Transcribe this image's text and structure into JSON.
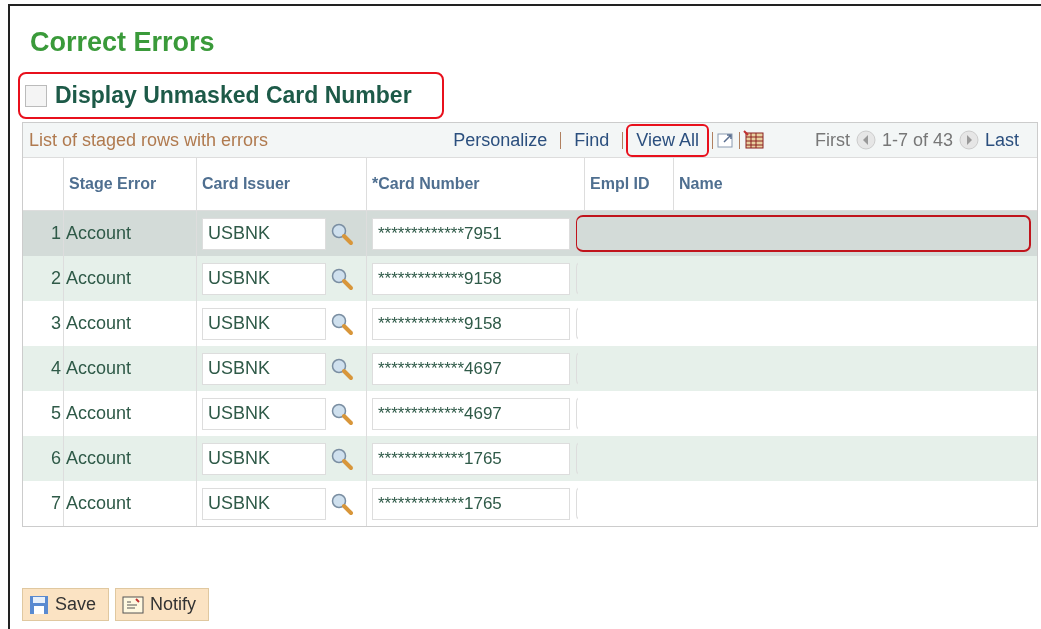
{
  "title": "Correct Errors",
  "unmask_option": {
    "label": "Display Unmasked Card Number",
    "checked": false,
    "highlighted": true
  },
  "grid": {
    "caption": "List of staged rows with errors",
    "links": [
      {
        "label": "Personalize",
        "highlighted": false
      },
      {
        "label": "Find",
        "highlighted": false
      },
      {
        "label": "View All",
        "highlighted": true
      }
    ],
    "pager": {
      "first": "First",
      "range": "1-7 of 43",
      "last": "Last"
    },
    "columns": [
      "Stage Error",
      "Card Issuer",
      "*Card Number",
      "Empl ID",
      "Name"
    ],
    "rows": [
      {
        "number": "1",
        "stage_error": "Account",
        "card_issuer": "USBNK",
        "card_number": "*************7951",
        "selected": true,
        "highlighted": true
      },
      {
        "number": "2",
        "stage_error": "Account",
        "card_issuer": "USBNK",
        "card_number": "*************9158",
        "selected": false,
        "highlighted": false
      },
      {
        "number": "3",
        "stage_error": "Account",
        "card_issuer": "USBNK",
        "card_number": "*************9158",
        "selected": false,
        "highlighted": false
      },
      {
        "number": "4",
        "stage_error": "Account",
        "card_issuer": "USBNK",
        "card_number": "*************4697",
        "selected": false,
        "highlighted": false
      },
      {
        "number": "5",
        "stage_error": "Account",
        "card_issuer": "USBNK",
        "card_number": "*************4697",
        "selected": false,
        "highlighted": false
      },
      {
        "number": "6",
        "stage_error": "Account",
        "card_issuer": "USBNK",
        "card_number": "*************1765",
        "selected": false,
        "highlighted": false
      },
      {
        "number": "7",
        "stage_error": "Account",
        "card_issuer": "USBNK",
        "card_number": "*************1765",
        "selected": false,
        "highlighted": false
      }
    ]
  },
  "buttons": [
    {
      "kind": "save",
      "label": "Save"
    },
    {
      "kind": "notify",
      "label": "Notify"
    }
  ]
}
